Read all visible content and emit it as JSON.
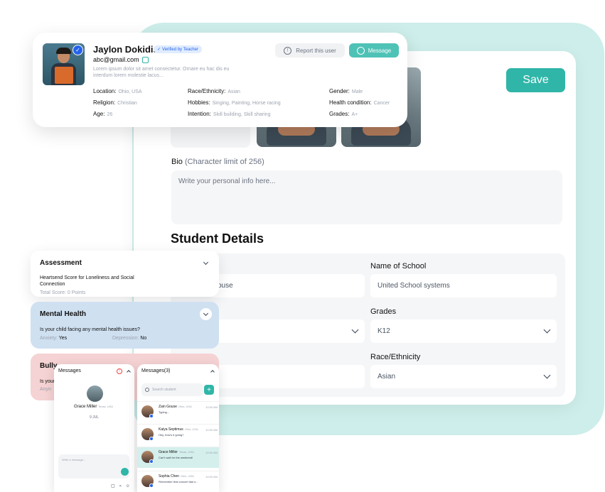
{
  "form": {
    "save_label": "Save",
    "bio_label": "Bio",
    "bio_hint": "(Character limit of 256)",
    "bio_placeholder": "Write your personal info here...",
    "section_title": "Student Details",
    "fields": {
      "first_value": "ouse",
      "school_label": "Name of School",
      "school_value": "United School systems",
      "grades_label": "Grades",
      "grades_value": "K12",
      "race_label": "Race/Ethnicity",
      "race_value": "Asian"
    }
  },
  "profile": {
    "name": "Jaylon Dokidis",
    "verified_label": "Verified by Teacher",
    "email": "abc@gmail.com",
    "description": "Lorem ipsum dolor sit amet consectetur. Ornare eu hac dis eu interdum lorem molestie lacus...",
    "report_label": "Report this user",
    "message_label": "Message",
    "details": {
      "location_key": "Location:",
      "location_val": "Ohio, USA",
      "religion_key": "Religion:",
      "religion_val": "Christian",
      "age_key": "Age:",
      "age_val": "26",
      "race_key": "Race/Ethnicity:",
      "race_val": "Asian",
      "hobbies_key": "Hobbies:",
      "hobbies_val": "Singing, Painting, Horse racing",
      "intention_key": "Intention:",
      "intention_val": "Skill building, Skill sharing",
      "gender_key": "Gender:",
      "gender_val": "Male",
      "health_key": "Health condition:",
      "health_val": "Cancer",
      "grades_key": "Grades:",
      "grades_val": "A+"
    }
  },
  "accordions": {
    "assessment": {
      "title": "Assessment",
      "question": "Heartsend Score for Loneliness and Social Connection",
      "score": "Total Score: 0 Points"
    },
    "mental": {
      "title": "Mental Health",
      "question": "Is your child facing any mental health issues?",
      "anxiety_key": "Anxiety:",
      "anxiety_val": "Yes",
      "depression_key": "Depression:",
      "depression_val": "No"
    },
    "bully": {
      "title": "Bully",
      "question": "Is your",
      "extra": "Anyo"
    }
  },
  "chat": {
    "title": "Messages",
    "contact_name": "Grace Miller",
    "contact_loc": "Texas, USA",
    "count": "9 JUL",
    "placeholder": "Write a message...",
    "tools": "▢ ⌁ ☺"
  },
  "messages": {
    "title": "Messages(3)",
    "search_placeholder": "Search student",
    "plus": "+",
    "conversations": [
      {
        "name": "Zain Gouse",
        "loc": "Ohio, USA",
        "msg": "Typing...",
        "time": "10:00 AM"
      },
      {
        "name": "Kaiya Septimus",
        "loc": "Ohio, USA",
        "msg": "Hey, how's it going?",
        "time": "10:00 AM"
      },
      {
        "name": "Grace Miller",
        "loc": "Texas, USA",
        "msg": "Can't wait for the weekend!",
        "time": "10:00 AM"
      },
      {
        "name": "Sophia Chen",
        "loc": "Ohio, USA",
        "msg": "Remember that concert last s...",
        "time": "10:00 AM"
      }
    ]
  },
  "colors": {
    "accent": "#30b6a8",
    "teal_bg": "#cdeeea",
    "mental_bg": "#cfe0f1",
    "bully_bg": "#f5d2d3",
    "verified_blue": "#2563eb"
  }
}
